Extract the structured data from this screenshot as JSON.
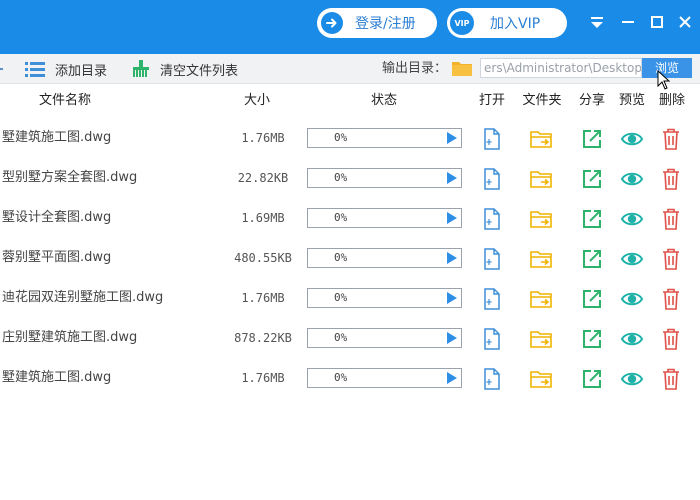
{
  "titlebar": {
    "login_label": "登录/注册",
    "vip_label": "加入VIP",
    "vip_badge": "VIP",
    "brand_color": "#1a8be6",
    "buttons": [
      "menu-icon",
      "minimize-icon",
      "maximize-icon",
      "close-icon"
    ]
  },
  "toolbar": {
    "add_dir_label": "添加目录",
    "clear_list_label": "清空文件列表",
    "output_dir_label": "输出目录：",
    "output_path": "ers\\Administrator\\Desktop",
    "browse_label": "浏览"
  },
  "table": {
    "headers": {
      "name": "文件名称",
      "size": "大小",
      "status": "状态",
      "open": "打开",
      "folder": "文件夹",
      "share": "分享",
      "preview": "预览",
      "delete": "删除"
    },
    "rows": [
      {
        "name": "墅建筑施工图.dwg",
        "size": "1.76MB",
        "progress": "0%"
      },
      {
        "name": "型别墅方案全套图.dwg",
        "size": "22.82KB",
        "progress": "0%"
      },
      {
        "name": "墅设计全套图.dwg",
        "size": "1.69MB",
        "progress": "0%"
      },
      {
        "name": "蓉别墅平面图.dwg",
        "size": "480.55KB",
        "progress": "0%"
      },
      {
        "name": "迪花园双连别墅施工图.dwg",
        "size": "1.76MB",
        "progress": "0%"
      },
      {
        "name": "庄别墅建筑施工图.dwg",
        "size": "878.22KB",
        "progress": "0%"
      },
      {
        "name": "墅建筑施工图.dwg",
        "size": "1.76MB",
        "progress": "0%"
      }
    ]
  },
  "colors": {
    "accent": "#1a8be6",
    "open_icon": "#3f8fd8",
    "folder_icon": "#f0b400",
    "share_icon": "#2eb36a",
    "preview_icon": "#20b2a9",
    "delete_icon": "#e0504a"
  }
}
